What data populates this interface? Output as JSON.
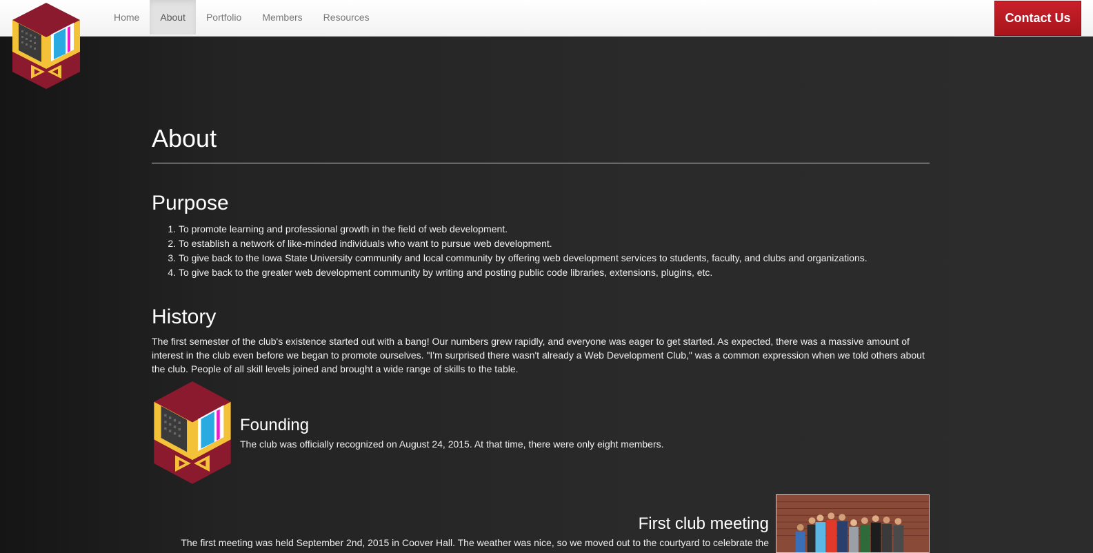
{
  "nav": {
    "items": [
      {
        "label": "Home",
        "active": false
      },
      {
        "label": "About",
        "active": true
      },
      {
        "label": "Portfolio",
        "active": false
      },
      {
        "label": "Members",
        "active": false
      },
      {
        "label": "Resources",
        "active": false
      }
    ],
    "contact_label": "Contact Us"
  },
  "main": {
    "title": "About",
    "purpose": {
      "title": "Purpose",
      "items": [
        {
          "num": "1.",
          "text": "To promote learning and professional growth in the field of web development."
        },
        {
          "num": "2.",
          "text": "To establish a network of like-minded individuals who want to pursue web development."
        },
        {
          "num": "3.",
          "text": "To give back to the Iowa State University community and local community by offering web development services to students, faculty, and clubs and organizations."
        },
        {
          "num": "4.",
          "text": "To give back to the greater web development community by writing and posting public code libraries, extensions, plugins, etc."
        }
      ]
    },
    "history": {
      "title": "History",
      "text": "The first semester of the club's existence started out with a bang! Our numbers grew rapidly, and everyone was eager to get started. As expected, there was a massive amount of interest in the club even before we began to promote ourselves. \"I'm surprised there wasn't already a Web Development Club,\" was a common expression when we told others about the club. People of all skill levels joined and brought a wide range of skills to the table."
    },
    "founding": {
      "title": "Founding",
      "text": "The club was officially recognized on August 24, 2015. At that time, there were only eight members."
    },
    "first_meeting": {
      "title": "First club meeting",
      "text": "The first meeting was held September 2nd, 2015 in Coover Hall. The weather was nice, so we moved out to the courtyard to celebrate the"
    }
  },
  "colors": {
    "brand_red": "#c9202a",
    "logo_crimson": "#8c1a2e",
    "logo_gold": "#f4c238",
    "logo_blue": "#29abe2",
    "logo_magenta": "#e91ec8"
  }
}
